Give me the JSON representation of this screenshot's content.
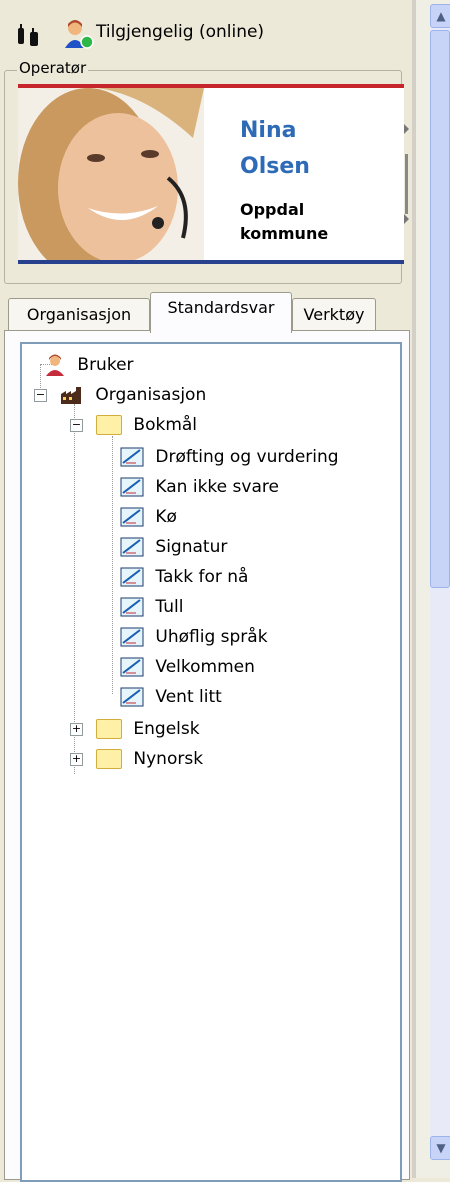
{
  "status": {
    "label": "Tilgjengelig (online)"
  },
  "operator": {
    "legend": "Operatør",
    "first_name": "Nina",
    "last_name": "Olsen",
    "org_line1": "Oppdal",
    "org_line2": "kommune"
  },
  "tabs": [
    {
      "label": "Organisasjon",
      "active": false
    },
    {
      "label": "Standardsvar",
      "active": true
    },
    {
      "label": "Verktøy",
      "active": false
    }
  ],
  "tree": {
    "user": "Bruker",
    "org": "Organisasjon",
    "folders": [
      {
        "label": "Bokmål",
        "expanded": true,
        "items": [
          "Drøfting og vurdering",
          "Kan ikke svare",
          "Kø",
          "Signatur",
          "Takk for nå",
          "Tull",
          "Uhøflig språk",
          "Velkommen",
          "Vent litt"
        ]
      },
      {
        "label": "Engelsk",
        "expanded": false
      },
      {
        "label": "Nynorsk",
        "expanded": false
      }
    ]
  },
  "colors": {
    "name": "#2d6bb7",
    "banner_red": "#c6252b",
    "banner_blue": "#27418e",
    "tree_border": "#7f9db9"
  }
}
